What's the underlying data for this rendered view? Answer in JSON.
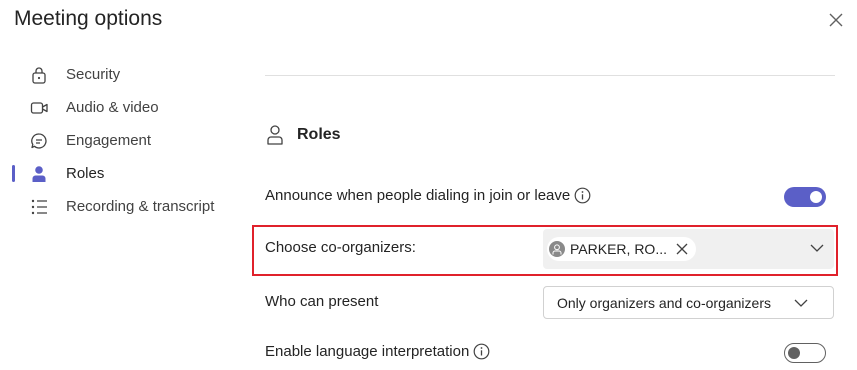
{
  "dialog": {
    "title": "Meeting options",
    "close_icon": "close-icon"
  },
  "nav": {
    "items": [
      {
        "label": "Security",
        "icon": "lock-icon"
      },
      {
        "label": "Audio & video",
        "icon": "video-camera-icon"
      },
      {
        "label": "Engagement",
        "icon": "chat-bubble-icon"
      },
      {
        "label": "Roles",
        "icon": "person-icon",
        "active": true
      },
      {
        "label": "Recording & transcript",
        "icon": "list-icon"
      }
    ],
    "active_color": "#5b5fc7"
  },
  "roles": {
    "heading": "Roles",
    "announce": {
      "label": "Announce when people dialing in join or leave",
      "enabled": true
    },
    "coorganizers": {
      "label": "Choose co-organizers:",
      "selected": [
        "PARKER, RO..."
      ]
    },
    "present": {
      "label": "Who can present",
      "value": "Only organizers and co-organizers"
    },
    "interpretation": {
      "label": "Enable language interpretation",
      "enabled": false
    }
  },
  "colors": {
    "accent": "#5b5fc7",
    "highlight_border": "#e0212b"
  }
}
